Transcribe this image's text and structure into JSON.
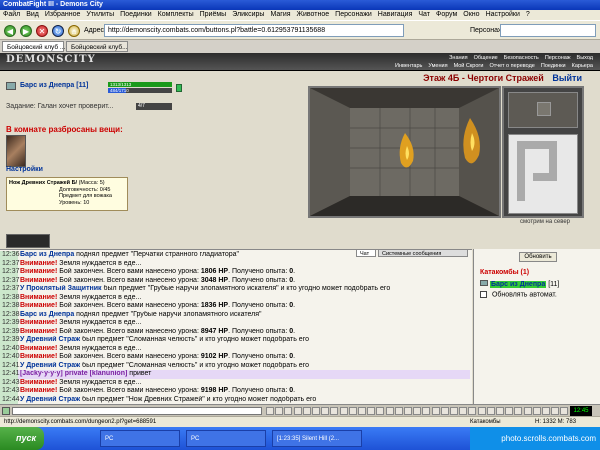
{
  "window": {
    "title": "CombatFight III - Demons City"
  },
  "menu": [
    "Файл",
    "Вид",
    "Избранное",
    "Утилиты",
    "Поединки",
    "Комплекты",
    "Приёмы",
    "Эликсиры",
    "Магия",
    "Животное",
    "Персонажи",
    "Навигация",
    "Чат",
    "Форум",
    "Окно",
    "Настройки",
    "?"
  ],
  "toolbar": {
    "address_label": "Адрес:",
    "address": "http://demonscity.combats.com/buttons.pl?battle=0.612953791135688",
    "persons_label": "Персонаж:"
  },
  "tabs": [
    "Бойцовский клуб ...",
    "Бойцовский клуб..."
  ],
  "site": {
    "logo": "DEMONSCITY",
    "nav_top": [
      "Знания",
      "Общение",
      "Безопасность",
      "Персонаж",
      "Выход"
    ],
    "nav_bottom": [
      "Инвентарь",
      "Умения",
      "Мой Скроги",
      "Отчет о переводе",
      "Поединки",
      "Карьера"
    ]
  },
  "character": {
    "name": "Барс из Днепра",
    "level": "[11]",
    "hp": "1313/1313",
    "mana": "484/1710",
    "task_label": "Задание: Галан хочет проверит...",
    "task_progress": "4/7"
  },
  "room": {
    "items_title": "В комнате разбросаны вещи:",
    "settings": "Настройки"
  },
  "tooltip": {
    "name": "Нож Древних Стражей Б/",
    "mass": "(Масса: 5)",
    "durability": "Долговечность: 0/45",
    "note": "Предмет для вожака",
    "level": "Уровень: 10"
  },
  "location": {
    "title": "Этаж 4Б - Чертоги Стражей",
    "exit": "Выйти",
    "look": "смотрим на север"
  },
  "chat": {
    "tabs": [
      "Чат",
      "Системные сообщения"
    ],
    "lines": [
      {
        "time": "12:36",
        "parts": [
          {
            "c": "blue",
            "t": "Барс из Днепра"
          },
          {
            "c": "",
            "t": " поднял предмет \"Перчатки странного гладиатора\""
          }
        ]
      },
      {
        "time": "12:37",
        "parts": [
          {
            "c": "red",
            "t": "Внимание!"
          },
          {
            "c": "",
            "t": " Земля нуждается в еде..."
          }
        ]
      },
      {
        "time": "12:37",
        "parts": [
          {
            "c": "red",
            "t": "Внимание!"
          },
          {
            "c": "",
            "t": " Бой закончен. Всего вами нанесено урона: "
          },
          {
            "c": "b",
            "t": "1806 HP"
          },
          {
            "c": "",
            "t": ". Получено опыта: "
          },
          {
            "c": "b",
            "t": "0"
          },
          {
            "c": "",
            "t": "."
          }
        ]
      },
      {
        "time": "12:37",
        "parts": [
          {
            "c": "red",
            "t": "Внимание!"
          },
          {
            "c": "",
            "t": " Бой закончен. Всего вами нанесено урона: "
          },
          {
            "c": "b",
            "t": "3048 HP"
          },
          {
            "c": "",
            "t": ". Получено опыта: "
          },
          {
            "c": "b",
            "t": "0"
          },
          {
            "c": "",
            "t": "."
          }
        ]
      },
      {
        "time": "12:37",
        "parts": [
          {
            "c": "blue",
            "t": "У Проклятый Защитник"
          },
          {
            "c": "",
            "t": " был предмет \"Грубые наручи злопамятного искателя\" и кто угодно может подобрать его"
          }
        ]
      },
      {
        "time": "12:38",
        "parts": [
          {
            "c": "red",
            "t": "Внимание!"
          },
          {
            "c": "",
            "t": " Земля нуждается в еде..."
          }
        ]
      },
      {
        "time": "12:38",
        "parts": [
          {
            "c": "red",
            "t": "Внимание!"
          },
          {
            "c": "",
            "t": " Бой закончен. Всего вами нанесено урона: "
          },
          {
            "c": "b",
            "t": "1836 HP"
          },
          {
            "c": "",
            "t": ". Получено опыта: "
          },
          {
            "c": "b",
            "t": "0"
          },
          {
            "c": "",
            "t": "."
          }
        ]
      },
      {
        "time": "12:38",
        "parts": [
          {
            "c": "blue",
            "t": "Барс из Днепра"
          },
          {
            "c": "",
            "t": " поднял предмет \"Грубые наручи злопамятного искателя\""
          }
        ]
      },
      {
        "time": "12:39",
        "parts": [
          {
            "c": "red",
            "t": "Внимание!"
          },
          {
            "c": "",
            "t": " Земля нуждается в еде..."
          }
        ]
      },
      {
        "time": "12:39",
        "parts": [
          {
            "c": "red",
            "t": "Внимание!"
          },
          {
            "c": "",
            "t": " Бой закончен. Всего вами нанесено урона: "
          },
          {
            "c": "b",
            "t": "8947 HP"
          },
          {
            "c": "",
            "t": ". Получено опыта: "
          },
          {
            "c": "b",
            "t": "0"
          },
          {
            "c": "",
            "t": "."
          }
        ]
      },
      {
        "time": "12:39",
        "parts": [
          {
            "c": "blue",
            "t": "У Древний Страж"
          },
          {
            "c": "",
            "t": " был предмет \"Сломанная челюсть\" и кто угодно может подобрать его"
          }
        ]
      },
      {
        "time": "12:40",
        "parts": [
          {
            "c": "red",
            "t": "Внимание!"
          },
          {
            "c": "",
            "t": " Земля нуждается в еде..."
          }
        ]
      },
      {
        "time": "12:40",
        "parts": [
          {
            "c": "red",
            "t": "Внимание!"
          },
          {
            "c": "",
            "t": " Бой закончен. Всего вами нанесено урона: "
          },
          {
            "c": "b",
            "t": "9102 HP"
          },
          {
            "c": "",
            "t": ". Получено опыта: "
          },
          {
            "c": "b",
            "t": "0"
          },
          {
            "c": "",
            "t": "."
          }
        ]
      },
      {
        "time": "12:41",
        "parts": [
          {
            "c": "blue",
            "t": "У Древний Страж"
          },
          {
            "c": "",
            "t": " был предмет \"Сломанная челюсть\" и кто угодно может подобрать его"
          }
        ]
      },
      {
        "time": "12:41",
        "hl": true,
        "parts": [
          {
            "c": "purple",
            "t": "[Jacky·y·y·y] private [klanunion]"
          },
          {
            "c": "",
            "t": " привет"
          }
        ]
      },
      {
        "time": "12:43",
        "parts": [
          {
            "c": "red",
            "t": "Внимание!"
          },
          {
            "c": "",
            "t": " Земля нуждается в еде..."
          }
        ]
      },
      {
        "time": "12:43",
        "parts": [
          {
            "c": "red",
            "t": "Внимание!"
          },
          {
            "c": "",
            "t": " Бой закончен. Всего вами нанесено урона: "
          },
          {
            "c": "b",
            "t": "9198 HP"
          },
          {
            "c": "",
            "t": ". Получено опыта: "
          },
          {
            "c": "b",
            "t": "0"
          },
          {
            "c": "",
            "t": "."
          }
        ]
      },
      {
        "time": "12:44",
        "parts": [
          {
            "c": "blue",
            "t": "У Древний Страж"
          },
          {
            "c": "",
            "t": " был предмет \"Нож Древних Стражей\" и кто угодно может подобрать его"
          }
        ]
      }
    ]
  },
  "side": {
    "refresh": "Обновить",
    "zone": "Катакомбы (1)",
    "member_name": "Барс из Днепра",
    "member_level": "[11]",
    "auto_refresh": "Обновлять автомат."
  },
  "clock": "12:45",
  "statusbar": {
    "url": "http://demonscity.combats.com/dungeon2.pl?get=688591",
    "zone": "Катакомбы",
    "coords": "H: 1332 М: 783"
  },
  "taskbar": {
    "start": "пуск",
    "apps": [
      "PC",
      "PC",
      "[1:23:35] Silent Hill (2..."
    ],
    "tray": "photo.scrolls.combats.com"
  }
}
